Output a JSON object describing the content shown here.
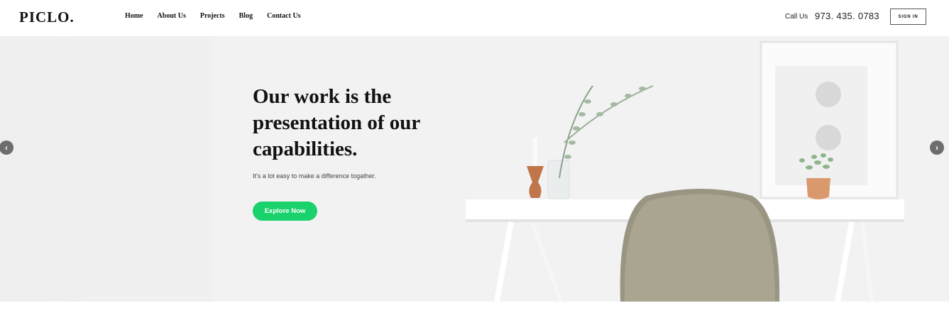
{
  "header": {
    "logo": "PICLO.",
    "nav": [
      "Home",
      "About Us",
      "Projects",
      "Blog",
      "Contact Us"
    ],
    "call_label": "Call Us",
    "phone": "973. 435. 0783",
    "signin_label": "SIGN IN"
  },
  "hero": {
    "headline": "Our work is the presentation of our capabilities.",
    "subtext": "It's a lot easy to make a difference togather.",
    "cta_label": "Explore Now",
    "prev_icon": "chevron-left-icon",
    "next_icon": "chevron-right-icon",
    "prev_glyph": "‹",
    "next_glyph": "›",
    "accent": "#19d26b"
  }
}
